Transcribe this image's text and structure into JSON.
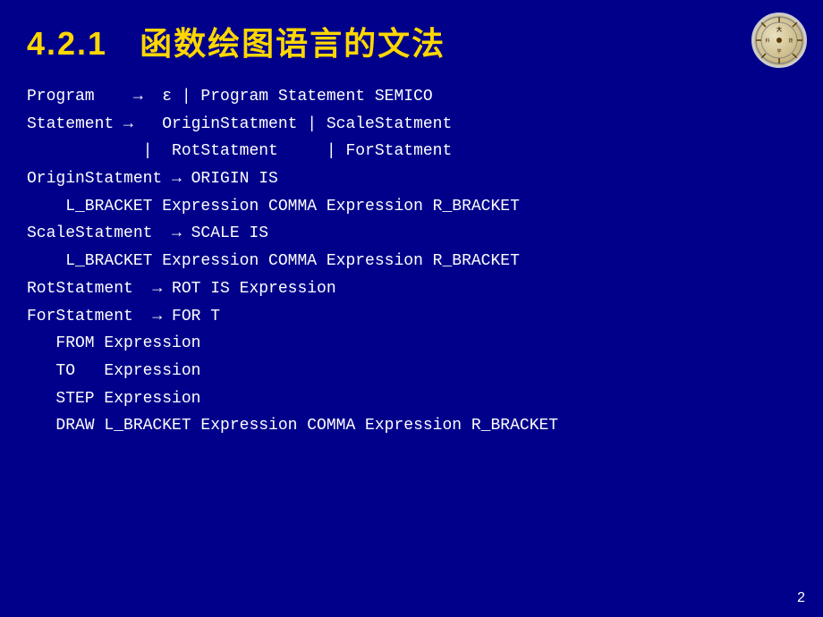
{
  "slide": {
    "title": {
      "number": "4.2.1",
      "chinese": "函数绘图语言的文法"
    },
    "grammar": [
      {
        "id": "line1",
        "text": "Program    →  ε | Program Statement SEMICO"
      },
      {
        "id": "line2",
        "text": "Statement →   OriginStatment | ScaleStatment"
      },
      {
        "id": "line3",
        "text": "            |  RotStatment     | ForStatment"
      },
      {
        "id": "line4",
        "text": "OriginStatment → ORIGIN IS"
      },
      {
        "id": "line5",
        "text": "    L_BRACKET Expression COMMA Expression R_BRACKET"
      },
      {
        "id": "line6",
        "text": "ScaleStatment  → SCALE IS"
      },
      {
        "id": "line7",
        "text": "    L_BRACKET Expression COMMA Expression R_BRACKET"
      },
      {
        "id": "line8",
        "text": "RotStatment  → ROT IS Expression"
      },
      {
        "id": "line9",
        "text": "ForStatment  → FOR T"
      },
      {
        "id": "line10",
        "text": "   FROM Expression"
      },
      {
        "id": "line11",
        "text": "   TO   Expression"
      },
      {
        "id": "line12",
        "text": "   STEP Expression"
      },
      {
        "id": "line13",
        "text": "   DRAW L_BRACKET Expression COMMA Expression R_BRACKET"
      }
    ],
    "page_number": "2"
  }
}
